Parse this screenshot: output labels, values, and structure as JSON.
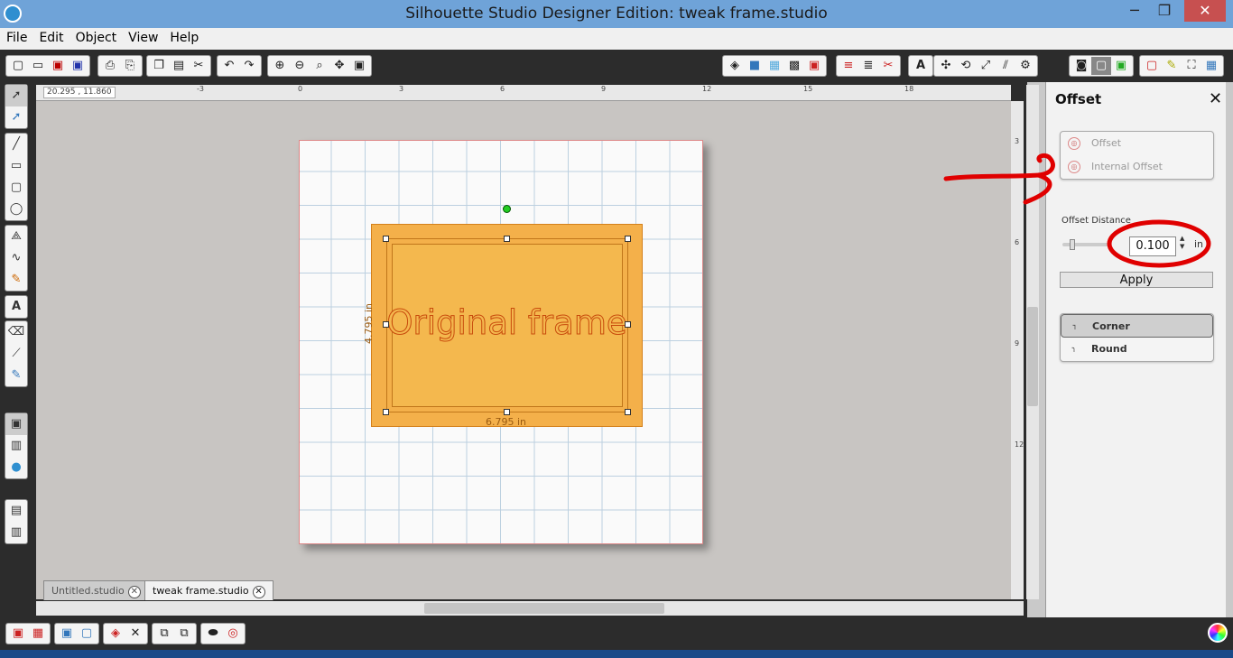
{
  "window": {
    "title": "Silhouette Studio Designer Edition: tweak frame.studio",
    "min": "─",
    "max": "❐",
    "close": "✕"
  },
  "menu": [
    "File",
    "Edit",
    "Object",
    "View",
    "Help"
  ],
  "ruler": {
    "coords": "20.295 , 11.860",
    "ticks": [
      "-3",
      "0",
      "3",
      "6",
      "9",
      "12",
      "15",
      "18"
    ],
    "vticks": [
      "3",
      "6",
      "9",
      "12"
    ]
  },
  "design": {
    "text": "Original frame",
    "width": "6.795 in",
    "height": "4.795 in"
  },
  "tabs": [
    {
      "label": "Untitled.studio",
      "close": "✕"
    },
    {
      "label": "tweak frame.studio",
      "close": "✕"
    }
  ],
  "panel": {
    "title": "Offset",
    "close": "✕",
    "options": [
      {
        "label": "Offset"
      },
      {
        "label": "Internal Offset"
      }
    ],
    "distance_label": "Offset Distance",
    "distance_value": "0.100",
    "unit": "in",
    "apply": "Apply",
    "corner_options": [
      {
        "label": "Corner",
        "selected": true
      },
      {
        "label": "Round",
        "selected": false
      }
    ]
  },
  "colors": {
    "frame_fill": "#f4b04a",
    "frame_stroke": "#c0761a",
    "annotation": "#e00000",
    "titlebar": "#6fa3d8"
  }
}
